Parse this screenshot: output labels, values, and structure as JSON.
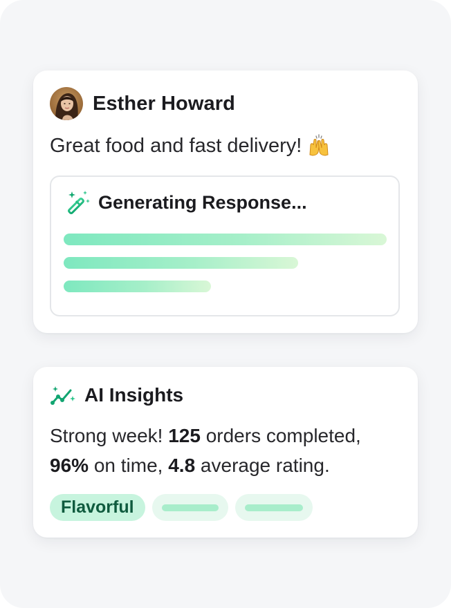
{
  "review": {
    "author_name": "Esther Howard",
    "text": "Great food and fast delivery!",
    "emoji": "raised-hands-icon",
    "generating": {
      "title": "Generating Response...",
      "icon": "magic-wand-icon"
    }
  },
  "insights": {
    "title": "AI Insights",
    "icon": "sparkle-trend-icon",
    "line1_prefix": "Strong week! ",
    "orders": "125",
    "line1_suffix": " orders completed,",
    "on_time": "96%",
    "on_time_suffix": " on time, ",
    "rating": "4.8",
    "rating_suffix": " average rating.",
    "tag": "Flavorful"
  },
  "colors": {
    "accent_green": "#0f9d6a",
    "chip_bg": "#c7f4de",
    "chip_text": "#0f5b3e",
    "bar_start": "#7ee8bf",
    "bar_end": "#d9f7d6"
  }
}
